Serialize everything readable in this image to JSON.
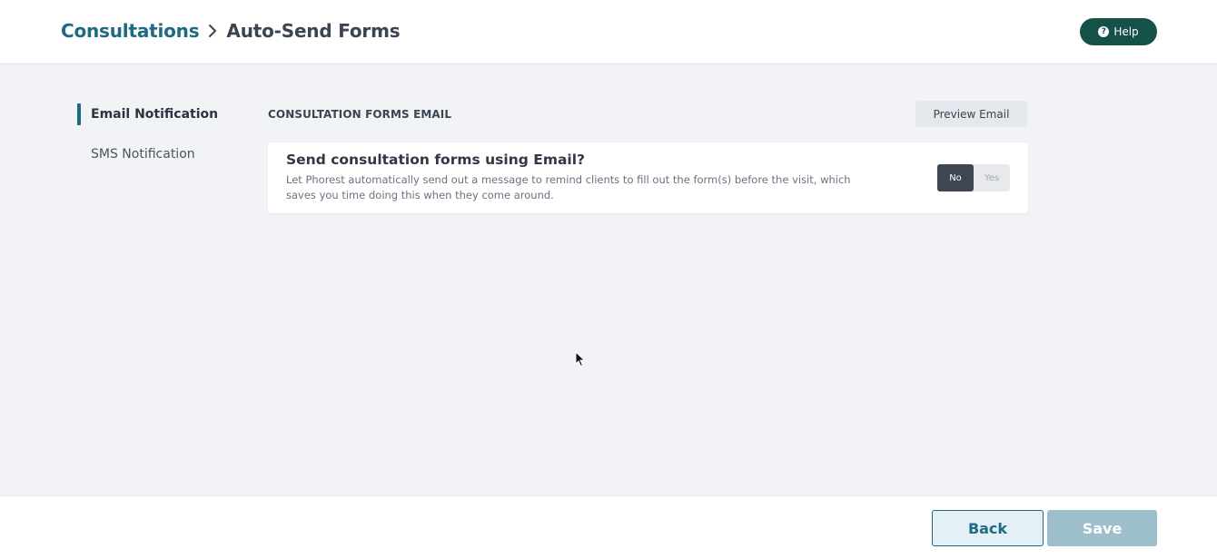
{
  "header": {
    "breadcrumb": {
      "parent": "Consultations",
      "current": "Auto-Send Forms"
    },
    "help_label": "Help"
  },
  "sidenav": {
    "items": [
      {
        "label": "Email Notification",
        "active": true
      },
      {
        "label": "SMS Notification",
        "active": false
      }
    ]
  },
  "main": {
    "section_title": "CONSULTATION FORMS EMAIL",
    "preview_label": "Preview Email",
    "card": {
      "title": "Send consultation forms using Email?",
      "description": "Let Phorest automatically send out a message to remind clients to fill out the form(s) before the visit, which saves you time doing this when they come around.",
      "toggle": {
        "options": [
          "No",
          "Yes"
        ],
        "selected": "No"
      }
    }
  },
  "footer": {
    "back_label": "Back",
    "save_label": "Save"
  },
  "colors": {
    "accent": "#1d6a82",
    "help_button": "#155147",
    "save_disabled": "#9dbfcb"
  }
}
